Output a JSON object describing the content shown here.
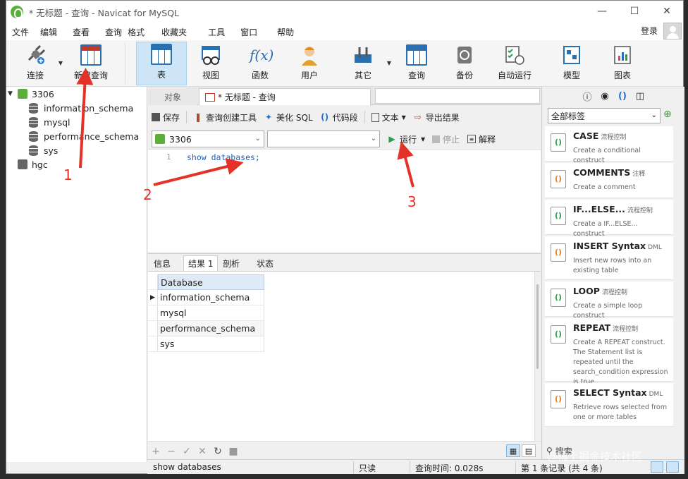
{
  "title_bar": {
    "title": "* 无标题 - 查询 - Navicat for MySQL"
  },
  "menu": {
    "items": [
      "文件",
      "编辑",
      "查看",
      "查询",
      "格式",
      "收藏夹",
      "工具",
      "窗口",
      "帮助"
    ],
    "login": "登录"
  },
  "toolbar": {
    "buttons": [
      "连接",
      "新建查询",
      "表",
      "视图",
      "函数",
      "用户",
      "其它",
      "查询",
      "备份",
      "自动运行",
      "模型",
      "图表"
    ]
  },
  "tree": {
    "connections": [
      {
        "name": "3306",
        "expanded": true,
        "databases": [
          "information_schema",
          "mysql",
          "performance_schema",
          "sys"
        ]
      },
      {
        "name": "hgc",
        "expanded": false
      }
    ]
  },
  "tabs": {
    "objects": "对象",
    "query": "* 无标题 - 查询"
  },
  "query_toolbar": {
    "save": "保存",
    "builder": "查询创建工具",
    "beautify": "美化 SQL",
    "snippet": "代码段",
    "text": "文本",
    "export": "导出结果"
  },
  "selectors": {
    "connection": "3306",
    "database": "",
    "run": "运行",
    "stop": "停止",
    "explain": "解释"
  },
  "editor": {
    "line_number": "1",
    "code": "show databases;"
  },
  "result_tabs": [
    "信息",
    "结果 1",
    "剖析",
    "状态"
  ],
  "result_grid": {
    "header": "Database",
    "rows": [
      "information_schema",
      "mysql",
      "performance_schema",
      "sys"
    ]
  },
  "right_panel": {
    "filter": "全部标签",
    "search_placeholder": "搜索",
    "snippets": [
      {
        "title": "CASE",
        "tag": "流程控制",
        "desc": "Create a conditional construct"
      },
      {
        "title": "COMMENTS",
        "tag": "注释",
        "desc": "Create a comment"
      },
      {
        "title": "IF...ELSE...",
        "tag": "流程控制",
        "desc": "Create a IF...ELSE... construct"
      },
      {
        "title": "INSERT Syntax",
        "tag": "DML",
        "desc": "Insert new rows into an existing table"
      },
      {
        "title": "LOOP",
        "tag": "流程控制",
        "desc": "Create a simple loop construct"
      },
      {
        "title": "REPEAT",
        "tag": "流程控制",
        "desc": "Create A REPEAT construct. The Statement list is repeated until the search_condition expression is true."
      },
      {
        "title": "SELECT Syntax",
        "tag": "DML",
        "desc": "Retrieve rows selected from one or more tables"
      }
    ]
  },
  "statusbar": {
    "sql": "show databases",
    "mode": "只读",
    "time": "查询时间: 0.028s",
    "records": "第 1 条记录 (共 4 条)"
  },
  "annotations": {
    "a1": "1",
    "a2": "2",
    "a3": "3"
  },
  "watermark": "@稀土掘金技术社区",
  "colors": {
    "annotation": "#e53228",
    "active_tool": "#cde5f7",
    "grid_header": "#dfeaf7",
    "connection_green": "#5cae3a"
  }
}
